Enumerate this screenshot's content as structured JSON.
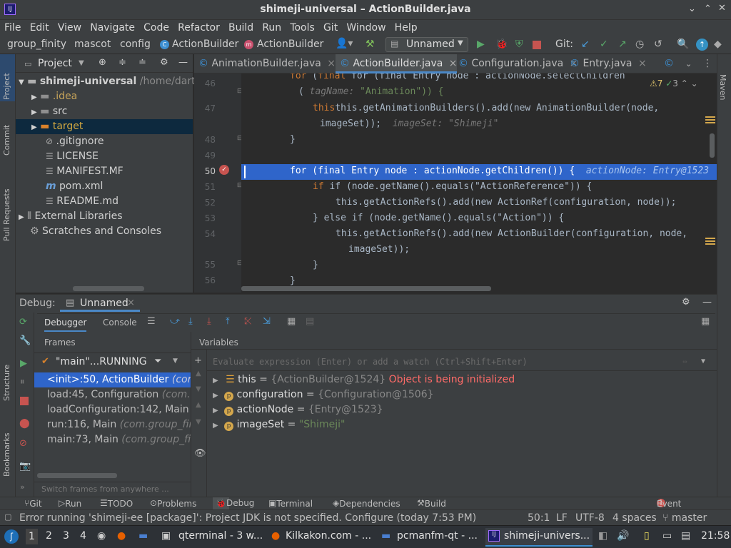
{
  "window": {
    "title": "shimeji-universal – ActionBuilder.java"
  },
  "menu": [
    "File",
    "Edit",
    "View",
    "Navigate",
    "Code",
    "Refactor",
    "Build",
    "Run",
    "Tools",
    "Git",
    "Window",
    "Help"
  ],
  "breadcrumb": [
    "group_finity",
    "mascot",
    "config",
    "ActionBuilder",
    "ActionBuilder"
  ],
  "run_config": "Unnamed",
  "git_label": "Git:",
  "project_panel": {
    "title": "Project",
    "tree": [
      {
        "label": "shimeji-universal",
        "path": "/home/dartz"
      },
      {
        "label": ".idea"
      },
      {
        "label": "src"
      },
      {
        "label": "target"
      },
      {
        "label": ".gitignore"
      },
      {
        "label": "LICENSE"
      },
      {
        "label": "MANIFEST.MF"
      },
      {
        "label": "pom.xml"
      },
      {
        "label": "README.md"
      },
      {
        "label": "External Libraries"
      },
      {
        "label": "Scratches and Consoles"
      }
    ]
  },
  "editor_tabs": [
    "AnimationBuilder.java",
    "ActionBuilder.java",
    "Configuration.java",
    "Entry.java"
  ],
  "inspection": {
    "warnings": "7",
    "ok": "3"
  },
  "code": {
    "l0": "for (final Entry node : actionNode.selectChildren",
    "l1_hint": "tagName:",
    "l1": "\"Animation\")) {",
    "l47": "this.getAnimationBuilders().add(new AnimationBuilder(node,",
    "l47b": "imageSet));",
    "l47b_hint": "imageSet: \"Shimeji\"",
    "l48": "}",
    "l50": "for (final Entry node : actionNode.getChildren()) {",
    "l50_hint": "actionNode: Entry@1523",
    "l51": "if (node.getName().equals(\"ActionReference\")) {",
    "l52": "this.getActionRefs().add(new ActionRef(configuration, node));",
    "l53": "} else if (node.getName().equals(\"Action\")) {",
    "l54": "this.getActionRefs().add(new ActionBuilder(configuration, node,",
    "l54b": "imageSet));",
    "l55": "}",
    "l56": "}",
    "line_numbers": [
      "46",
      "47",
      "48",
      "49",
      "50",
      "51",
      "52",
      "53",
      "54",
      "55",
      "56"
    ]
  },
  "debug": {
    "label": "Debug:",
    "session": "Unnamed",
    "tabs": [
      "Debugger",
      "Console"
    ],
    "frames_title": "Frames",
    "variables_title": "Variables",
    "thread": "\"main\"...RUNNING",
    "frames": [
      {
        "name": "<init>:50, ActionBuilder",
        "pkg": "(com."
      },
      {
        "name": "load:45, Configuration",
        "pkg": "(com.gr"
      },
      {
        "name": "loadConfiguration:142, Main",
        "pkg": "(c"
      },
      {
        "name": "run:116, Main",
        "pkg": "(com.group_finit"
      },
      {
        "name": "main:73, Main",
        "pkg": "(com.group_finit"
      }
    ],
    "switch_hint": "Switch frames from anywhere ...",
    "eval_placeholder": "Evaluate expression (Enter) or add a watch (Ctrl+Shift+Enter)",
    "variables": [
      {
        "name": "this",
        "value": "{ActionBuilder@1524}",
        "note": "Object is being initialized"
      },
      {
        "name": "configuration",
        "value": "{Configuration@1506}"
      },
      {
        "name": "actionNode",
        "value": "{Entry@1523}"
      },
      {
        "name": "imageSet",
        "value": "\"Shimeji\""
      }
    ]
  },
  "bottom_tools": [
    "Git",
    "Run",
    "TODO",
    "Problems",
    "Debug",
    "Terminal",
    "Dependencies",
    "Build"
  ],
  "event_log": "Event Log",
  "event_count": "1",
  "status": {
    "message": "Error running 'shimeji-ee [package]': Project JDK is not specified. Configure (today 7:53 PM)",
    "position": "50:1",
    "line_sep": "LF",
    "encoding": "UTF-8",
    "indent": "4 spaces",
    "branch": "master"
  },
  "side_tabs_left": [
    "Project",
    "Commit",
    "Pull Requests",
    "Structure",
    "Bookmarks"
  ],
  "side_tabs_right": [
    "Maven"
  ],
  "taskbar": {
    "workspaces": [
      "1",
      "2",
      "3",
      "4"
    ],
    "apps": [
      "qterminal - 3 w...",
      "Kilkakon.com - ...",
      "pcmanfm-qt - ...",
      "shimeji-univers..."
    ],
    "clock": "21:58"
  },
  "colors": {
    "accent": "#2f65ca",
    "keyword": "#cc7832",
    "string": "#6a8759",
    "field": "#9876aa",
    "error": "#ff6b68"
  }
}
